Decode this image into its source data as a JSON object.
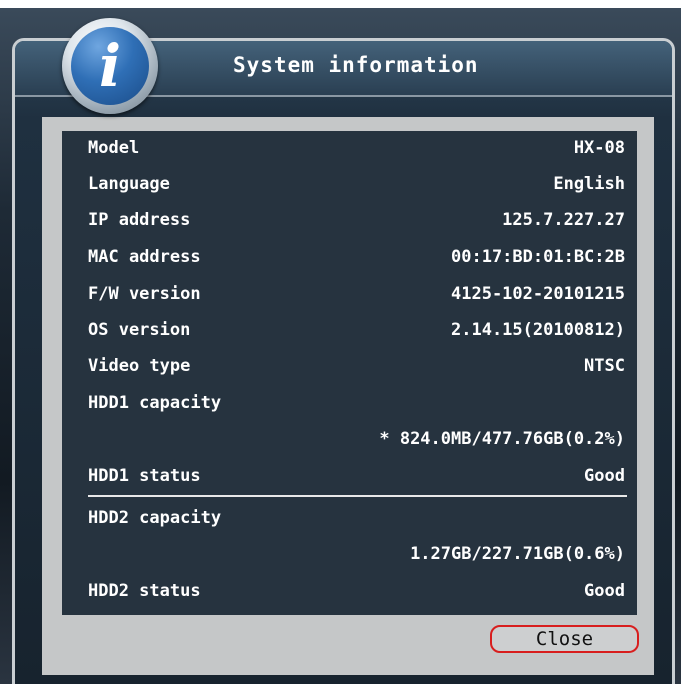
{
  "dialog": {
    "title": "System information",
    "close_label": "Close"
  },
  "rows": [
    {
      "label": "Model",
      "value": "HX-08"
    },
    {
      "label": "Language",
      "value": "English"
    },
    {
      "label": "IP address",
      "value": "125.7.227.27"
    },
    {
      "label": "MAC address",
      "value": "00:17:BD:01:BC:2B"
    },
    {
      "label": "F/W version",
      "value": "4125-102-20101215"
    },
    {
      "label": "OS version",
      "value": "2.14.15(20100812)"
    },
    {
      "label": "Video type",
      "value": "NTSC"
    },
    {
      "label": "HDD1 capacity",
      "value": ""
    },
    {
      "label": "",
      "value": "* 824.0MB/477.76GB(0.2%)"
    },
    {
      "label": "HDD1 status",
      "value": "Good"
    },
    {
      "label": "HDD2 capacity",
      "value": ""
    },
    {
      "label": "",
      "value": "1.27GB/227.71GB(0.6%)"
    },
    {
      "label": "HDD2 status",
      "value": "Good"
    }
  ],
  "icons": {
    "info_icon": "info-icon"
  }
}
